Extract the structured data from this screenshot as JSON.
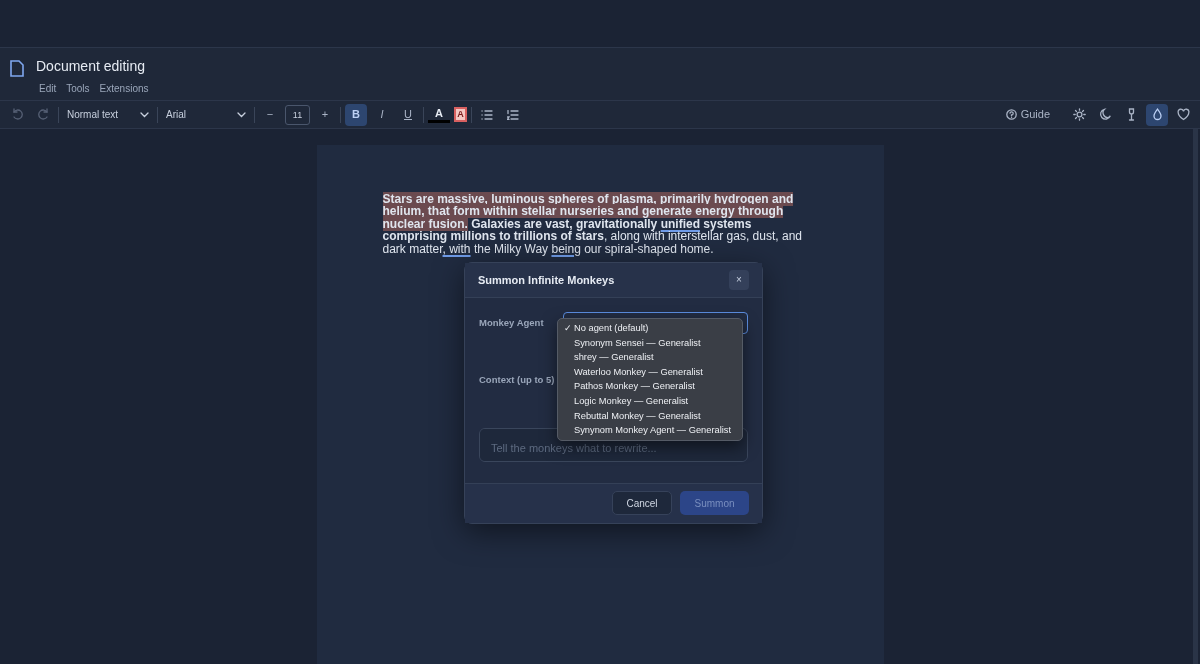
{
  "document": {
    "title": "Document editing",
    "menu": [
      "Edit",
      "Tools",
      "Extensions"
    ]
  },
  "toolbar": {
    "undo_disabled": true,
    "redo_disabled": true,
    "style": "Normal text",
    "font": "Arial",
    "size_minus": "−",
    "font_size": "11",
    "size_plus": "+",
    "format_buttons": [
      {
        "kind": "bold",
        "label": "B",
        "selected": true
      },
      {
        "kind": "italic",
        "label": "I",
        "selected": false
      },
      {
        "kind": "underline",
        "label": "U",
        "selected": false
      }
    ],
    "color_buttons": [
      {
        "kind": "text",
        "label": "A",
        "color": "#000000"
      },
      {
        "kind": "highlight",
        "label": "A",
        "color": "#f4c7c3"
      }
    ],
    "guide": "Guide",
    "themes": [
      {
        "kind": "sun",
        "selected": false
      },
      {
        "kind": "moon",
        "selected": false
      },
      {
        "kind": "glass",
        "selected": false
      },
      {
        "kind": "drop",
        "selected": true
      },
      {
        "kind": "heart",
        "selected": false
      }
    ]
  },
  "paragraph": [
    {
      "text": "Stars are massive, luminous spheres of plasma, primarily hydrogen and helium, that form within stellar nurseries and generate energy through nuclear fusion.",
      "kind": "highlighted-bold"
    },
    {
      "text": " Galaxies are vast, gravitationally ",
      "kind": "bold"
    },
    {
      "text": "unified",
      "kind": "underlined-bold"
    },
    {
      "text": " systems comprising millions to trillions of stars",
      "kind": "bold"
    },
    {
      "text": ", along with interstellar gas, dust, and dark matter",
      "kind": "plain"
    },
    {
      "text": ", with",
      "kind": "underlined"
    },
    {
      "text": " the Milky Way ",
      "kind": "plain"
    },
    {
      "text": "being",
      "kind": "underlined"
    },
    {
      "text": " our spiral-shaped home.",
      "kind": "plain"
    }
  ],
  "dialog": {
    "title": "Summon Infinite Monkeys",
    "close": "×",
    "agent_label": "Monkey Agent",
    "context_label": "Context (up to 5)",
    "placeholder": "Tell the monkeys what to rewrite...",
    "agents": [
      {
        "label": "No agent (default)",
        "selected": true
      },
      {
        "label": "Synonym Sensei — Generalist",
        "selected": false
      },
      {
        "label": "shrey — Generalist",
        "selected": false
      },
      {
        "label": "Waterloo Monkey — Generalist",
        "selected": false
      },
      {
        "label": "Pathos Monkey — Generalist",
        "selected": false
      },
      {
        "label": "Logic Monkey — Generalist",
        "selected": false
      },
      {
        "label": "Rebuttal Monkey — Generalist",
        "selected": false
      },
      {
        "label": "Synynom Monkey Agent — Generalist",
        "selected": false
      }
    ],
    "check": "✓",
    "cancel": "Cancel",
    "summon": "Summon",
    "summon_disabled": true
  }
}
